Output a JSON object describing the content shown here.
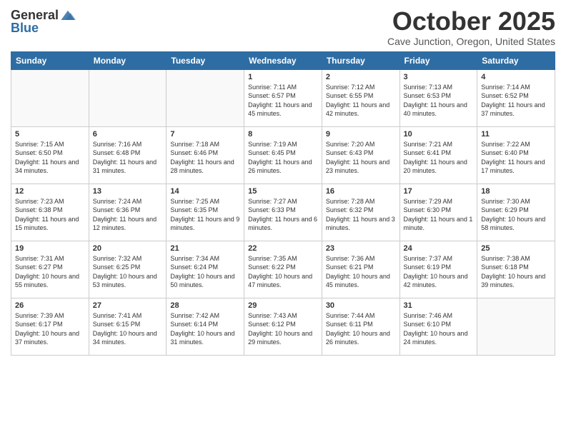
{
  "header": {
    "logo_line1": "General",
    "logo_line2": "Blue",
    "month_title": "October 2025",
    "location": "Cave Junction, Oregon, United States"
  },
  "weekdays": [
    "Sunday",
    "Monday",
    "Tuesday",
    "Wednesday",
    "Thursday",
    "Friday",
    "Saturday"
  ],
  "weeks": [
    [
      {
        "day": "",
        "sunrise": "",
        "sunset": "",
        "daylight": ""
      },
      {
        "day": "",
        "sunrise": "",
        "sunset": "",
        "daylight": ""
      },
      {
        "day": "",
        "sunrise": "",
        "sunset": "",
        "daylight": ""
      },
      {
        "day": "1",
        "sunrise": "Sunrise: 7:11 AM",
        "sunset": "Sunset: 6:57 PM",
        "daylight": "Daylight: 11 hours and 45 minutes."
      },
      {
        "day": "2",
        "sunrise": "Sunrise: 7:12 AM",
        "sunset": "Sunset: 6:55 PM",
        "daylight": "Daylight: 11 hours and 42 minutes."
      },
      {
        "day": "3",
        "sunrise": "Sunrise: 7:13 AM",
        "sunset": "Sunset: 6:53 PM",
        "daylight": "Daylight: 11 hours and 40 minutes."
      },
      {
        "day": "4",
        "sunrise": "Sunrise: 7:14 AM",
        "sunset": "Sunset: 6:52 PM",
        "daylight": "Daylight: 11 hours and 37 minutes."
      }
    ],
    [
      {
        "day": "5",
        "sunrise": "Sunrise: 7:15 AM",
        "sunset": "Sunset: 6:50 PM",
        "daylight": "Daylight: 11 hours and 34 minutes."
      },
      {
        "day": "6",
        "sunrise": "Sunrise: 7:16 AM",
        "sunset": "Sunset: 6:48 PM",
        "daylight": "Daylight: 11 hours and 31 minutes."
      },
      {
        "day": "7",
        "sunrise": "Sunrise: 7:18 AM",
        "sunset": "Sunset: 6:46 PM",
        "daylight": "Daylight: 11 hours and 28 minutes."
      },
      {
        "day": "8",
        "sunrise": "Sunrise: 7:19 AM",
        "sunset": "Sunset: 6:45 PM",
        "daylight": "Daylight: 11 hours and 26 minutes."
      },
      {
        "day": "9",
        "sunrise": "Sunrise: 7:20 AM",
        "sunset": "Sunset: 6:43 PM",
        "daylight": "Daylight: 11 hours and 23 minutes."
      },
      {
        "day": "10",
        "sunrise": "Sunrise: 7:21 AM",
        "sunset": "Sunset: 6:41 PM",
        "daylight": "Daylight: 11 hours and 20 minutes."
      },
      {
        "day": "11",
        "sunrise": "Sunrise: 7:22 AM",
        "sunset": "Sunset: 6:40 PM",
        "daylight": "Daylight: 11 hours and 17 minutes."
      }
    ],
    [
      {
        "day": "12",
        "sunrise": "Sunrise: 7:23 AM",
        "sunset": "Sunset: 6:38 PM",
        "daylight": "Daylight: 11 hours and 15 minutes."
      },
      {
        "day": "13",
        "sunrise": "Sunrise: 7:24 AM",
        "sunset": "Sunset: 6:36 PM",
        "daylight": "Daylight: 11 hours and 12 minutes."
      },
      {
        "day": "14",
        "sunrise": "Sunrise: 7:25 AM",
        "sunset": "Sunset: 6:35 PM",
        "daylight": "Daylight: 11 hours and 9 minutes."
      },
      {
        "day": "15",
        "sunrise": "Sunrise: 7:27 AM",
        "sunset": "Sunset: 6:33 PM",
        "daylight": "Daylight: 11 hours and 6 minutes."
      },
      {
        "day": "16",
        "sunrise": "Sunrise: 7:28 AM",
        "sunset": "Sunset: 6:32 PM",
        "daylight": "Daylight: 11 hours and 3 minutes."
      },
      {
        "day": "17",
        "sunrise": "Sunrise: 7:29 AM",
        "sunset": "Sunset: 6:30 PM",
        "daylight": "Daylight: 11 hours and 1 minute."
      },
      {
        "day": "18",
        "sunrise": "Sunrise: 7:30 AM",
        "sunset": "Sunset: 6:29 PM",
        "daylight": "Daylight: 10 hours and 58 minutes."
      }
    ],
    [
      {
        "day": "19",
        "sunrise": "Sunrise: 7:31 AM",
        "sunset": "Sunset: 6:27 PM",
        "daylight": "Daylight: 10 hours and 55 minutes."
      },
      {
        "day": "20",
        "sunrise": "Sunrise: 7:32 AM",
        "sunset": "Sunset: 6:25 PM",
        "daylight": "Daylight: 10 hours and 53 minutes."
      },
      {
        "day": "21",
        "sunrise": "Sunrise: 7:34 AM",
        "sunset": "Sunset: 6:24 PM",
        "daylight": "Daylight: 10 hours and 50 minutes."
      },
      {
        "day": "22",
        "sunrise": "Sunrise: 7:35 AM",
        "sunset": "Sunset: 6:22 PM",
        "daylight": "Daylight: 10 hours and 47 minutes."
      },
      {
        "day": "23",
        "sunrise": "Sunrise: 7:36 AM",
        "sunset": "Sunset: 6:21 PM",
        "daylight": "Daylight: 10 hours and 45 minutes."
      },
      {
        "day": "24",
        "sunrise": "Sunrise: 7:37 AM",
        "sunset": "Sunset: 6:19 PM",
        "daylight": "Daylight: 10 hours and 42 minutes."
      },
      {
        "day": "25",
        "sunrise": "Sunrise: 7:38 AM",
        "sunset": "Sunset: 6:18 PM",
        "daylight": "Daylight: 10 hours and 39 minutes."
      }
    ],
    [
      {
        "day": "26",
        "sunrise": "Sunrise: 7:39 AM",
        "sunset": "Sunset: 6:17 PM",
        "daylight": "Daylight: 10 hours and 37 minutes."
      },
      {
        "day": "27",
        "sunrise": "Sunrise: 7:41 AM",
        "sunset": "Sunset: 6:15 PM",
        "daylight": "Daylight: 10 hours and 34 minutes."
      },
      {
        "day": "28",
        "sunrise": "Sunrise: 7:42 AM",
        "sunset": "Sunset: 6:14 PM",
        "daylight": "Daylight: 10 hours and 31 minutes."
      },
      {
        "day": "29",
        "sunrise": "Sunrise: 7:43 AM",
        "sunset": "Sunset: 6:12 PM",
        "daylight": "Daylight: 10 hours and 29 minutes."
      },
      {
        "day": "30",
        "sunrise": "Sunrise: 7:44 AM",
        "sunset": "Sunset: 6:11 PM",
        "daylight": "Daylight: 10 hours and 26 minutes."
      },
      {
        "day": "31",
        "sunrise": "Sunrise: 7:46 AM",
        "sunset": "Sunset: 6:10 PM",
        "daylight": "Daylight: 10 hours and 24 minutes."
      },
      {
        "day": "",
        "sunrise": "",
        "sunset": "",
        "daylight": ""
      }
    ]
  ]
}
